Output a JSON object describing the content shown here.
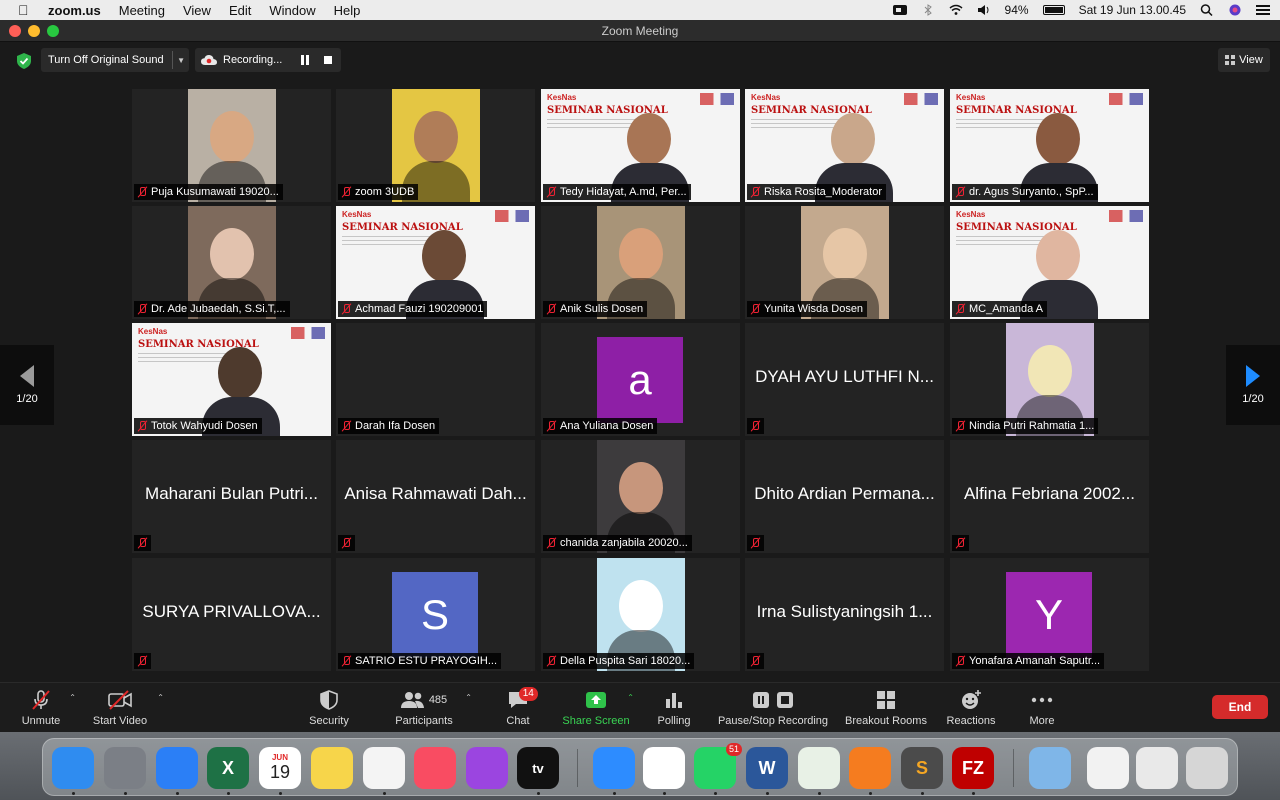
{
  "menubar": {
    "app": "zoom.us",
    "items": [
      "Meeting",
      "View",
      "Edit",
      "Window",
      "Help"
    ],
    "battery": "94%",
    "clock": "Sat 19 Jun  13.00.45"
  },
  "window": {
    "title": "Zoom Meeting"
  },
  "topbar": {
    "original_sound": "Turn Off Original Sound",
    "recording": "Recording...",
    "view": "View"
  },
  "pager": {
    "left": "1/20",
    "right": "1/20"
  },
  "participants": [
    {
      "name": "Puja Kusumawati 19020...",
      "kind": "video",
      "bg": "#b9b0a4",
      "face": "#d8a883"
    },
    {
      "name": "zoom 3UDB",
      "kind": "video",
      "bg": "#e4c643",
      "face": "#b07d58"
    },
    {
      "name": "Tedy Hidayat, A.md, Per...",
      "kind": "banner",
      "face": "#a87555"
    },
    {
      "name": "Riska Rosita_Moderator",
      "kind": "banner",
      "face": "#c9a78b",
      "active": true
    },
    {
      "name": "dr. Agus Suryanto., SpP...",
      "kind": "banner",
      "face": "#8a5a40"
    },
    {
      "name": "Dr. Ade Jubaedah, S.Si.T,...",
      "kind": "video",
      "bg": "#7e6a5c",
      "face": "#e2c2ae"
    },
    {
      "name": "Achmad Fauzi 190209001",
      "kind": "banner",
      "face": "#6b4a36"
    },
    {
      "name": "Anik Sulis Dosen",
      "kind": "video",
      "bg": "#a89478",
      "face": "#d9a07a"
    },
    {
      "name": "Yunita Wisda Dosen",
      "kind": "video",
      "bg": "#c3a98e",
      "face": "#e6c6a6"
    },
    {
      "name": "MC_Amanda A",
      "kind": "banner",
      "face": "#e0b6a0"
    },
    {
      "name": "Totok Wahyudi Dosen",
      "kind": "banner",
      "face": "#4e3a2d"
    },
    {
      "name": "Darah Ifa Dosen",
      "kind": "blank"
    },
    {
      "name": "Ana Yuliana Dosen",
      "kind": "avatar",
      "letter": "a",
      "color": "#8e1fa6"
    },
    {
      "name": "DYAH AYU LUTHFI N...",
      "kind": "text"
    },
    {
      "name": "Nindia Putri Rahmatia 1...",
      "kind": "video",
      "bg": "#c9b7d8",
      "face": "#f1e6b6"
    },
    {
      "name": "Maharani Bulan Putri...",
      "kind": "text"
    },
    {
      "name": "Anisa Rahmawati Dah...",
      "kind": "text"
    },
    {
      "name": "chanida zanjabila 20020...",
      "kind": "video",
      "bg": "#3d3b3d",
      "face": "#c7967c"
    },
    {
      "name": "Dhito Ardian Permana...",
      "kind": "text"
    },
    {
      "name": "Alfina Febriana 2002...",
      "kind": "text"
    },
    {
      "name": "SURYA PRIVALLOVA...",
      "kind": "text"
    },
    {
      "name": "SATRIO ESTU PRAYOGIH...",
      "kind": "avatar",
      "letter": "S",
      "color": "#5367c4"
    },
    {
      "name": "Della Puspita Sari 18020...",
      "kind": "video",
      "bg": "#bfe2ef",
      "face": "#ffffff"
    },
    {
      "name": "Irna Sulistyaningsih 1...",
      "kind": "text"
    },
    {
      "name": "Yonafara Amanah Saputr...",
      "kind": "avatar",
      "letter": "Y",
      "color": "#9c27b0"
    }
  ],
  "banner_text": {
    "brand": "KesNas",
    "headline": "SEMINAR NASIONAL"
  },
  "toolbar": {
    "unmute": "Unmute",
    "start_video": "Start Video",
    "security": "Security",
    "participants": "Participants",
    "participants_count": "485",
    "chat": "Chat",
    "chat_badge": "14",
    "share": "Share Screen",
    "polling": "Polling",
    "recording": "Pause/Stop Recording",
    "breakout": "Breakout Rooms",
    "reactions": "Reactions",
    "more": "More",
    "end": "End"
  },
  "dock": {
    "calendar_month": "JUN",
    "calendar_day": "19",
    "whatsapp_badge": "51",
    "apps": [
      {
        "id": "finder",
        "color": "#2f8cf0"
      },
      {
        "id": "launchpad",
        "color": "#7b7f86"
      },
      {
        "id": "safari",
        "color": "#2b7ff6"
      },
      {
        "id": "excel",
        "color": "#1e7145"
      },
      {
        "id": "calendar",
        "color": "#ffffff"
      },
      {
        "id": "notes",
        "color": "#f7d54a"
      },
      {
        "id": "reminders",
        "color": "#f4f4f4"
      },
      {
        "id": "music",
        "color": "#f94c62"
      },
      {
        "id": "podcasts",
        "color": "#9b45e0"
      },
      {
        "id": "appletv",
        "color": "#111111"
      },
      {
        "id": "zoom",
        "color": "#2d8cff"
      },
      {
        "id": "chrome",
        "color": "#ffffff"
      },
      {
        "id": "whatsapp",
        "color": "#25d366"
      },
      {
        "id": "word",
        "color": "#2b579a"
      },
      {
        "id": "anaconda",
        "color": "#e8f1e6"
      },
      {
        "id": "app-orange",
        "color": "#f57c1f"
      },
      {
        "id": "sublime",
        "color": "#4b4b4b"
      },
      {
        "id": "filezilla",
        "color": "#bf0000"
      },
      {
        "id": "downloads",
        "color": "#7fb6e8"
      },
      {
        "id": "doc-preview",
        "color": "#f2f2f2"
      },
      {
        "id": "zoom-window",
        "color": "#e9e9e9"
      },
      {
        "id": "trash",
        "color": "#d6d6d6"
      }
    ]
  }
}
